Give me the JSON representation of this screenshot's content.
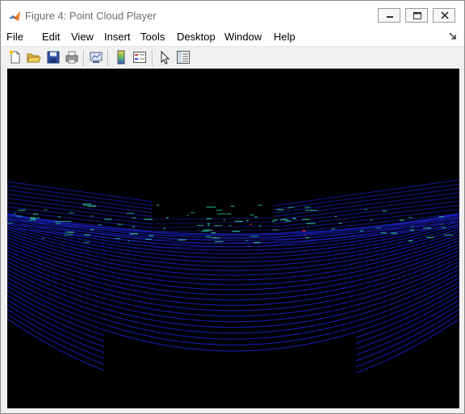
{
  "window": {
    "title": "Figure 4: Point Cloud Player"
  },
  "titlebar": {
    "app_icon": "matlab-logo-icon",
    "buttons": [
      "minimize-icon",
      "maximize-icon",
      "close-icon"
    ]
  },
  "menubar": {
    "items": [
      {
        "label": "File"
      },
      {
        "label": "Edit"
      },
      {
        "label": "View"
      },
      {
        "label": "Insert"
      },
      {
        "label": "Tools"
      },
      {
        "label": "Desktop"
      },
      {
        "label": "Window"
      },
      {
        "label": "Help"
      }
    ],
    "dock_icon": "dock-arrow-icon"
  },
  "toolbar": {
    "icons": [
      "new-figure-icon",
      "open-file-icon",
      "save-icon",
      "print-icon",
      "link-plot-icon",
      "insert-colorbar-icon",
      "insert-legend-icon",
      "edit-plot-arrow-icon",
      "property-inspector-icon"
    ]
  },
  "plot": {
    "background": "#000000",
    "point_color_primary": "#1a22c8",
    "point_color_highlight": "#2fd0a0",
    "point_color_hot": "#e02020"
  }
}
